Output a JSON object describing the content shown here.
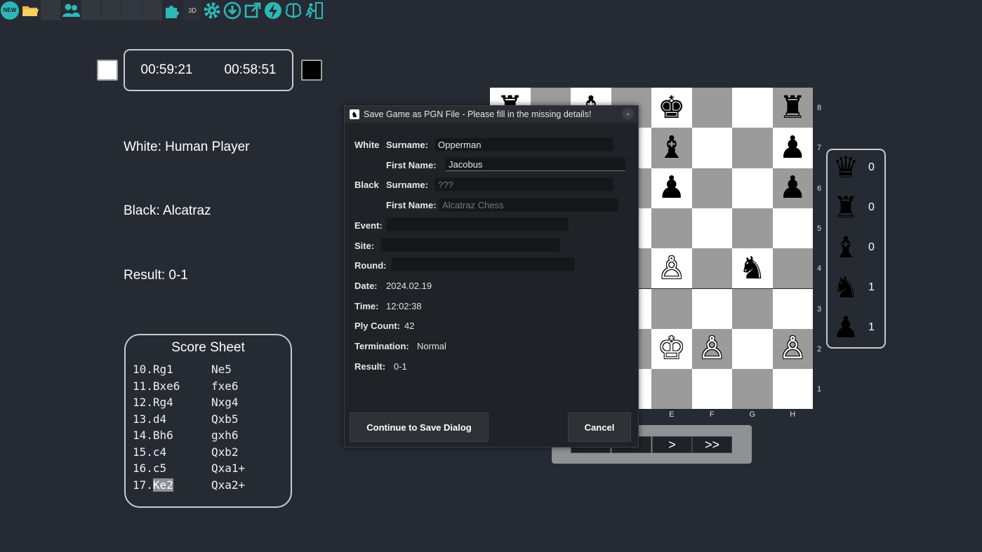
{
  "toolbar": {
    "new_label": "NEW",
    "threed_label": "3D"
  },
  "clock": {
    "white_time": "00:59:21",
    "black_time": "00:58:51"
  },
  "players": {
    "white": "White: Human Player",
    "black": "Black: Alcatraz",
    "result": "Result: 0-1"
  },
  "score_sheet": {
    "title": "Score Sheet",
    "moves": [
      {
        "num": "10.",
        "white": "Rg1",
        "black": "Ne5"
      },
      {
        "num": "11.",
        "white": "Bxe6",
        "black": "fxe6"
      },
      {
        "num": "12.",
        "white": "Rg4",
        "black": "Nxg4"
      },
      {
        "num": "13.",
        "white": "d4",
        "black": "Qxb5"
      },
      {
        "num": "14.",
        "white": "Bh6",
        "black": "gxh6"
      },
      {
        "num": "15.",
        "white": "c4",
        "black": "Qxb2"
      },
      {
        "num": "16.",
        "white": "c5",
        "black": "Qxa1+"
      },
      {
        "num": "17.",
        "white": "Ke2",
        "black": "Qxa2+"
      }
    ]
  },
  "board": {
    "ranks": [
      "8",
      "7",
      "6",
      "5",
      "4",
      "3",
      "2",
      "1"
    ],
    "files": [
      "E",
      "F",
      "G",
      "H"
    ],
    "pieces": [
      {
        "file": 0,
        "rank": 8,
        "glyph": "♜",
        "color": "b"
      },
      {
        "file": 2,
        "rank": 8,
        "glyph": "♝",
        "color": "b"
      },
      {
        "file": 4,
        "rank": 8,
        "glyph": "♚",
        "color": "b"
      },
      {
        "file": 7,
        "rank": 8,
        "glyph": "♜",
        "color": "b"
      },
      {
        "file": 4,
        "rank": 7,
        "glyph": "♝",
        "color": "b"
      },
      {
        "file": 7,
        "rank": 7,
        "glyph": "♟",
        "color": "b"
      },
      {
        "file": 4,
        "rank": 6,
        "glyph": "♟",
        "color": "b"
      },
      {
        "file": 7,
        "rank": 6,
        "glyph": "♟",
        "color": "b"
      },
      {
        "file": 4,
        "rank": 4,
        "glyph": "♙",
        "color": "w"
      },
      {
        "file": 6,
        "rank": 4,
        "glyph": "♞",
        "color": "b"
      },
      {
        "file": 4,
        "rank": 2,
        "glyph": "♔",
        "color": "w"
      },
      {
        "file": 5,
        "rank": 2,
        "glyph": "♙",
        "color": "w"
      },
      {
        "file": 7,
        "rank": 2,
        "glyph": "♙",
        "color": "w"
      }
    ]
  },
  "captured": [
    {
      "piece": "queen-icon",
      "glyph": "♛",
      "count": "0"
    },
    {
      "piece": "rook-icon",
      "glyph": "♜",
      "count": "0"
    },
    {
      "piece": "bishop-icon",
      "glyph": "♝",
      "count": "0"
    },
    {
      "piece": "knight-icon",
      "glyph": "♞",
      "count": "1"
    },
    {
      "piece": "pawn-icon",
      "glyph": "♟",
      "count": "1"
    }
  ],
  "nav": {
    "first": "<<",
    "prev": "<",
    "next": ">",
    "last": ">>"
  },
  "dialog": {
    "title": "Save Game as PGN File - Please fill in the missing details!",
    "close": "×",
    "white_label": "White",
    "black_label": "Black",
    "surname_label": "Surname:",
    "firstname_label": "First Name:",
    "white_surname": "Opperman",
    "white_firstname": "Jacobus",
    "black_surname_placeholder": "???",
    "black_firstname_placeholder": "Alcatraz Chess",
    "event_label": "Event:",
    "site_label": "Site:",
    "round_label": "Round:",
    "date_label": "Date:",
    "date_value": "2024.02.19",
    "time_label": "Time:",
    "time_value": "12:02:38",
    "plycount_label": "Ply Count:",
    "plycount_value": "42",
    "termination_label": "Termination:",
    "termination_value": "Normal",
    "result_label": "Result:",
    "result_value": "0-1",
    "continue_button": "Continue to Save Dialog",
    "cancel_button": "Cancel"
  },
  "colors": {
    "background": "#262b33",
    "accent": "#2fb7b7",
    "light_square": "#ffffff",
    "dark_square": "#9b9b9b"
  }
}
